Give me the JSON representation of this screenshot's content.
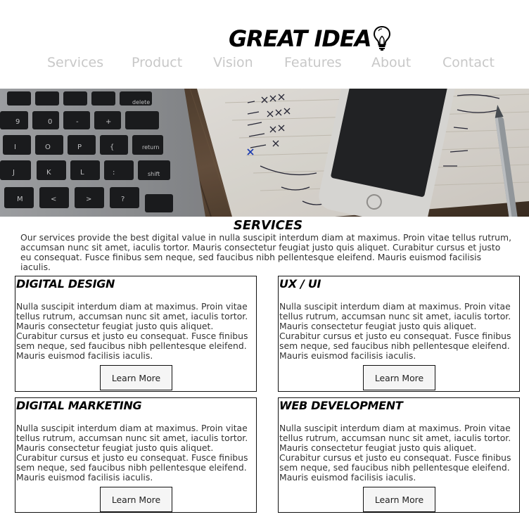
{
  "header": {
    "logo_text": "GREAT IDEA",
    "nav": [
      {
        "label": "Services"
      },
      {
        "label": "Product"
      },
      {
        "label": "Vision"
      },
      {
        "label": "Features"
      },
      {
        "label": "About"
      },
      {
        "label": "Contact"
      }
    ]
  },
  "services": {
    "title": "SERVICES",
    "intro": "Our services provide the best digital value in nulla suscipit interdum diam at maximus. Proin vitae tellus rutrum, accumsan nunc sit amet, iaculis tortor. Mauris consectetur feugiat justo quis aliquet. Curabitur cursus et justo eu consequat. Fusce finibus sem neque, sed faucibus nibh pellentesque eleifend. Mauris euismod facilisis iaculis.",
    "cards": [
      {
        "title": "DIGITAL DESIGN",
        "body": "Nulla suscipit interdum diam at maximus. Proin vitae tellus rutrum, accumsan nunc sit amet, iaculis tortor. Mauris consectetur feugiat justo quis aliquet. Curabitur cursus et justo eu consequat. Fusce finibus sem neque, sed faucibus nibh pellentesque eleifend. Mauris euismod facilisis iaculis.",
        "button": "Learn More"
      },
      {
        "title": "UX / UI",
        "body": "Nulla suscipit interdum diam at maximus. Proin vitae tellus rutrum, accumsan nunc sit amet, iaculis tortor. Mauris consectetur feugiat justo quis aliquet. Curabitur cursus et justo eu consequat. Fusce finibus sem neque, sed faucibus nibh pellentesque eleifend. Mauris euismod facilisis iaculis.",
        "button": "Learn More"
      },
      {
        "title": "DIGITAL MARKETING",
        "body": "Nulla suscipit interdum diam at maximus. Proin vitae tellus rutrum, accumsan nunc sit amet, iaculis tortor. Mauris consectetur feugiat justo quis aliquet. Curabitur cursus et justo eu consequat. Fusce finibus sem neque, sed faucibus nibh pellentesque eleifend. Mauris euismod facilisis iaculis.",
        "button": "Learn More"
      },
      {
        "title": "WEB DEVELOPMENT",
        "body": "Nulla suscipit interdum diam at maximus. Proin vitae tellus rutrum, accumsan nunc sit amet, iaculis tortor. Mauris consectetur feugiat justo quis aliquet. Curabitur cursus et justo eu consequat. Fusce finibus sem neque, sed faucibus nibh pellentesque eleifend. Mauris euismod facilisis iaculis.",
        "button": "Learn More"
      }
    ]
  },
  "hero": {
    "icon": "desk-photo-laptop-phone-notebook"
  },
  "colors": {
    "nav_text": "#c8c8c8",
    "text": "#333333",
    "border": "#111111",
    "button_bg": "#f5f5f5"
  }
}
